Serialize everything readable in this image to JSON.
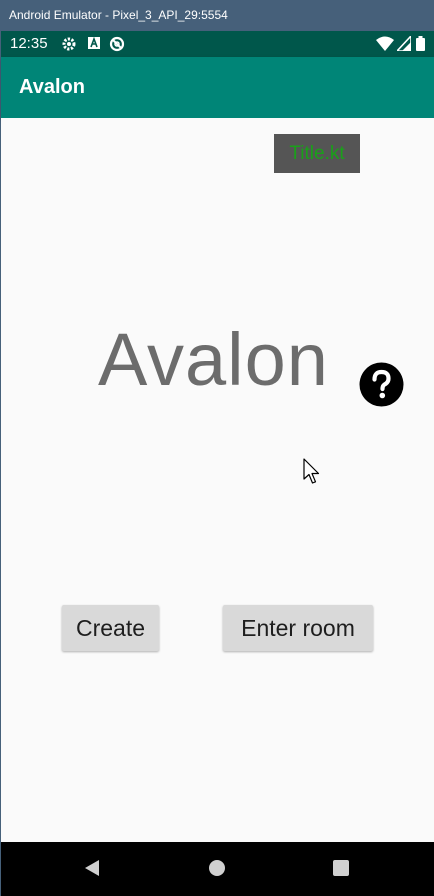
{
  "window": {
    "title": "Android Emulator - Pixel_3_API_29:5554"
  },
  "status_bar": {
    "time": "12:35",
    "left_icons": [
      "gear-icon",
      "a-box-icon",
      "do-not-disturb-icon"
    ],
    "right_icons": [
      "wifi-icon",
      "cell-signal-icon",
      "battery-icon"
    ]
  },
  "app_bar": {
    "title": "Avalon"
  },
  "main": {
    "file_tag": "Title.kt",
    "big_title": "Avalon",
    "help_icon": "question-circle-icon",
    "create_button": "Create",
    "enter_room_button": "Enter room"
  },
  "nav_bar": {
    "items": [
      "back-icon",
      "home-icon",
      "recents-icon"
    ]
  },
  "colors": {
    "window_title_bg": "#46607a",
    "status_bar_bg": "#00574b",
    "app_bar_bg": "#008577",
    "file_tag_bg": "#555555",
    "file_tag_text": "#1aa01a",
    "big_title_text": "#6c6c6c",
    "button_bg": "#d9d9d9"
  }
}
